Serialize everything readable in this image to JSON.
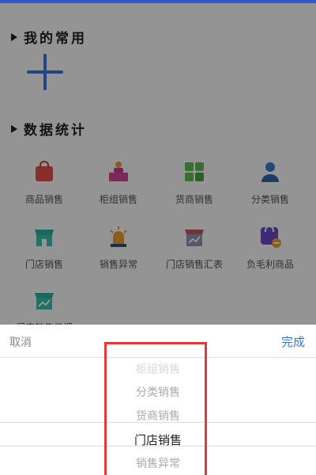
{
  "sections": {
    "favorites": {
      "title": "我的常用"
    },
    "stats": {
      "title": "数据统计"
    }
  },
  "grid": [
    {
      "label": "商品销售",
      "icon": "shopping-bag-icon"
    },
    {
      "label": "柜组销售",
      "icon": "counter-clerk-icon"
    },
    {
      "label": "货商销售",
      "icon": "grid-tiles-icon"
    },
    {
      "label": "分类销售",
      "icon": "person-icon"
    },
    {
      "label": "门店销售",
      "icon": "storefront-icon"
    },
    {
      "label": "销售异常",
      "icon": "alarm-icon"
    },
    {
      "label": "门店销售汇表",
      "icon": "store-chart-icon"
    },
    {
      "label": "负毛利商品",
      "icon": "cart-minus-icon"
    },
    {
      "label": "门店销售日报",
      "icon": "store-daily-icon"
    }
  ],
  "sheet": {
    "cancel_label": "取消",
    "done_label": "完成"
  },
  "picker": {
    "options": [
      "柜组销售",
      "分类销售",
      "货商销售",
      "门店销售",
      "销售异常"
    ],
    "selected": "门店销售"
  },
  "colors": {
    "accent": "#2c7be5",
    "highlight": "#e53935"
  }
}
